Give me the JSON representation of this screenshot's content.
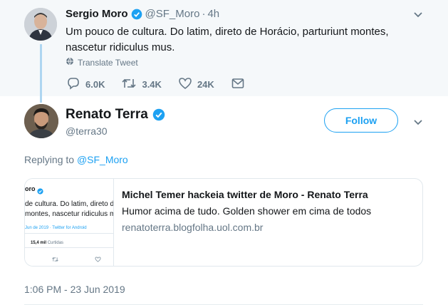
{
  "parent_tweet": {
    "name": "Sergio Moro",
    "handle": "@SF_Moro",
    "separator": "·",
    "time": "4h",
    "text": "Um pouco de cultura. Do latim, direto de Horácio, parturiunt montes, nascetur ridiculus mus.",
    "translate_label": "Translate Tweet",
    "replies": "6.0K",
    "retweets": "3.4K",
    "likes": "24K"
  },
  "main_tweet": {
    "name": "Renato Terra",
    "handle": "@terra30",
    "follow_label": "Follow",
    "replying_prefix": "Replying to",
    "replying_handle": "@SF_Moro",
    "card": {
      "title": "Michel Temer hackeia twitter de Moro - Renato Terra",
      "description": "Humor acima de tudo. Golden shower em cima de todos",
      "domain": "renatoterra.blogfolha.uol.com.br",
      "thumbnail": {
        "name_fragment": "oro",
        "line1": "de cultura. Do latim, direto de",
        "line2": "montes, nascetur ridiculus mus.",
        "meta": "Jun de 2019 · Twitter for Android",
        "likes_count": "15,4 mil",
        "likes_label": "Curtidas"
      }
    },
    "timestamp": "1:06 PM - 23 Jun 2019"
  },
  "colors": {
    "accent": "#1da1f2",
    "secondary_text": "#657786",
    "top_background": "#f5f8fa",
    "thread_line": "#aed6f1"
  }
}
